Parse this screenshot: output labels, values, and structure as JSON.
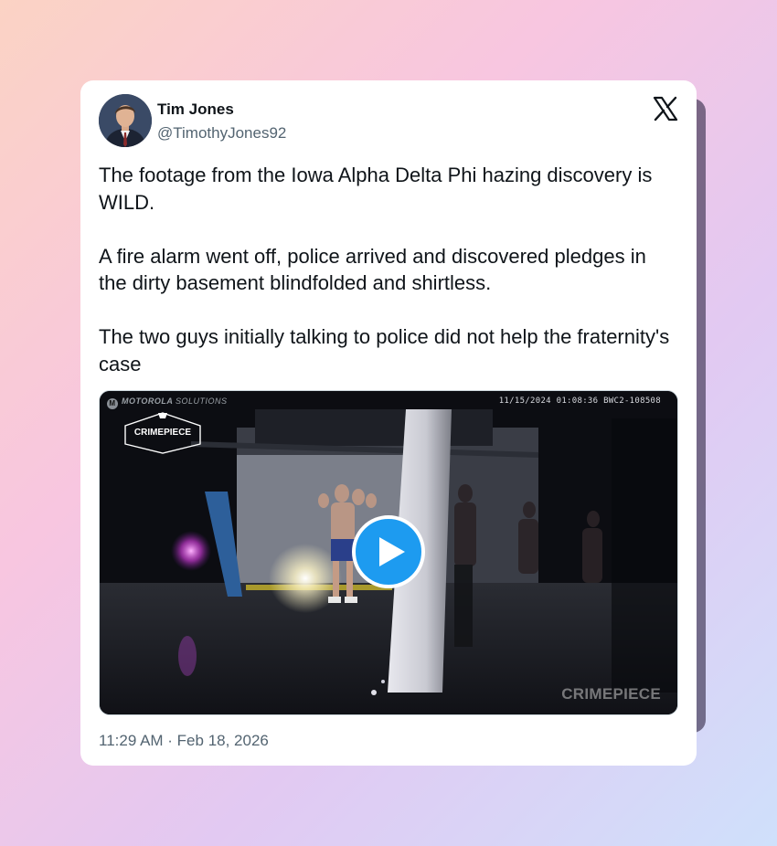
{
  "author": {
    "name": "Tim Jones",
    "handle": "@TimothyJones92"
  },
  "tweet": {
    "paragraphs": [
      "The footage from the Iowa Alpha Delta Phi hazing discovery is WILD.",
      "A fire alarm went off, police arrived and discovered pledges in the dirty basement blindfolded and shirtless.",
      "The two guys initially talking to police did not help the fraternity's case"
    ],
    "timestamp": "11:29 AM · Feb 18, 2026"
  },
  "media": {
    "camera_brand": "MOTOROLA",
    "camera_brand_suffix": "SOLUTIONS",
    "camera_stamp": "11/15/2024 01:08:36 BWC2-108508",
    "badge_label": "CRIMEPIECE",
    "watermark": "CRIMEPIECE",
    "play_icon": "play-icon"
  },
  "icons": {
    "platform": "x-logo-icon"
  },
  "colors": {
    "play_button": "#1d9bf0",
    "text": "#0f1419",
    "secondary_text": "#536471"
  }
}
